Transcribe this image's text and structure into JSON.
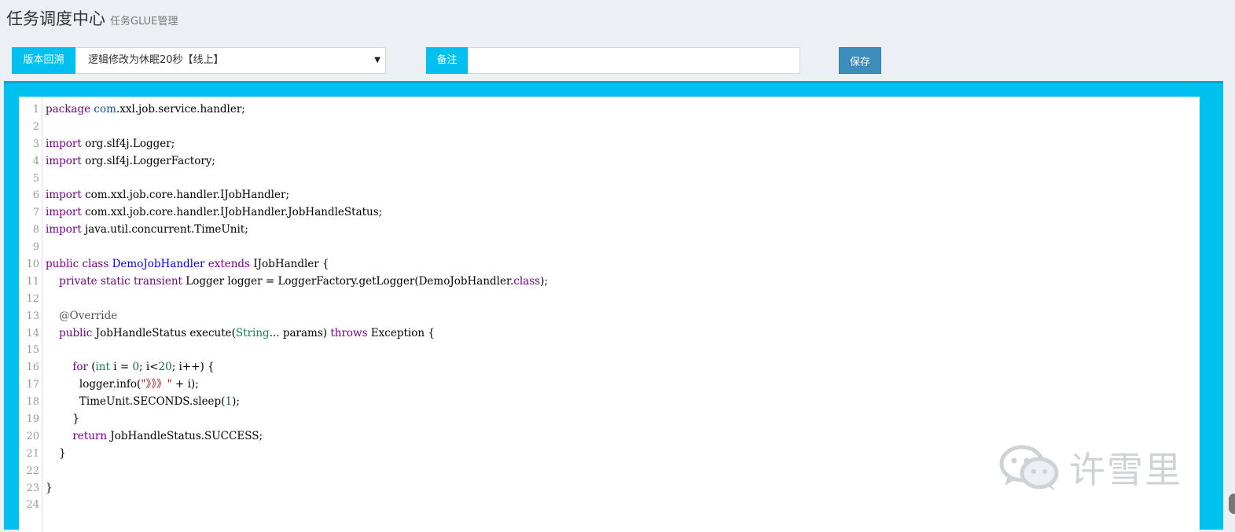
{
  "header": {
    "title": "任务调度中心",
    "subtitle": "任务GLUE管理"
  },
  "toolbar": {
    "version_label": "版本回溯",
    "version_selected": "逻辑修改为休眠20秒【线上】",
    "remark_label": "备注",
    "remark_value": "",
    "save_label": "保存"
  },
  "editor": {
    "line_numbers": [
      "1",
      "2",
      "3",
      "4",
      "5",
      "6",
      "7",
      "8",
      "9",
      "10",
      "11",
      "12",
      "13",
      "14",
      "15",
      "16",
      "17",
      "18",
      "19",
      "20",
      "21",
      "22",
      "23",
      "24"
    ],
    "lines": [
      [
        {
          "t": "package",
          "c": "kw"
        },
        {
          "t": " "
        },
        {
          "t": "com",
          "c": "var2"
        },
        {
          "t": ".xxl.job.service.handler;"
        }
      ],
      [],
      [
        {
          "t": "import",
          "c": "kw"
        },
        {
          "t": " org.slf4j.Logger;"
        }
      ],
      [
        {
          "t": "import",
          "c": "kw"
        },
        {
          "t": " org.slf4j.LoggerFactory;"
        }
      ],
      [],
      [
        {
          "t": "import",
          "c": "kw"
        },
        {
          "t": " com.xxl.job.core.handler.IJobHandler;"
        }
      ],
      [
        {
          "t": "import",
          "c": "kw"
        },
        {
          "t": " com.xxl.job.core.handler.IJobHandler.JobHandleStatus;"
        }
      ],
      [
        {
          "t": "import",
          "c": "kw"
        },
        {
          "t": " java.util.concurrent.TimeUnit;"
        }
      ],
      [],
      [
        {
          "t": "public",
          "c": "kw"
        },
        {
          "t": " "
        },
        {
          "t": "class",
          "c": "kw"
        },
        {
          "t": " "
        },
        {
          "t": "DemoJobHandler",
          "c": "def"
        },
        {
          "t": " "
        },
        {
          "t": "extends",
          "c": "kw"
        },
        {
          "t": " IJobHandler {"
        }
      ],
      [
        {
          "t": "    "
        },
        {
          "t": "private",
          "c": "kw"
        },
        {
          "t": " "
        },
        {
          "t": "static",
          "c": "kw"
        },
        {
          "t": " "
        },
        {
          "t": "transient",
          "c": "kw"
        },
        {
          "t": " Logger logger = LoggerFactory.getLogger(DemoJobHandler."
        },
        {
          "t": "class",
          "c": "kw"
        },
        {
          "t": ");"
        }
      ],
      [],
      [
        {
          "t": "    "
        },
        {
          "t": "@Override",
          "c": "meta"
        }
      ],
      [
        {
          "t": "    "
        },
        {
          "t": "public",
          "c": "kw"
        },
        {
          "t": " JobHandleStatus execute("
        },
        {
          "t": "String",
          "c": "type"
        },
        {
          "t": "... params) "
        },
        {
          "t": "throws",
          "c": "kw"
        },
        {
          "t": " Exception {"
        }
      ],
      [],
      [
        {
          "t": "        "
        },
        {
          "t": "for",
          "c": "kw"
        },
        {
          "t": " ("
        },
        {
          "t": "int",
          "c": "type"
        },
        {
          "t": " i = "
        },
        {
          "t": "0",
          "c": "num"
        },
        {
          "t": "; i<"
        },
        {
          "t": "20",
          "c": "num"
        },
        {
          "t": "; i++) {"
        }
      ],
      [
        {
          "t": "          logger.info("
        },
        {
          "t": "\"》》》\"",
          "c": "str"
        },
        {
          "t": " + i);"
        }
      ],
      [
        {
          "t": "          TimeUnit.SECONDS.sleep("
        },
        {
          "t": "1",
          "c": "num"
        },
        {
          "t": ");"
        }
      ],
      [
        {
          "t": "        }"
        }
      ],
      [
        {
          "t": "        "
        },
        {
          "t": "return",
          "c": "kw"
        },
        {
          "t": " JobHandleStatus.SUCCESS;"
        }
      ],
      [
        {
          "t": "    }"
        }
      ],
      [],
      [
        {
          "t": "}"
        }
      ],
      []
    ]
  },
  "watermark": {
    "icon": "wechat-icon",
    "text": "许雪里"
  }
}
